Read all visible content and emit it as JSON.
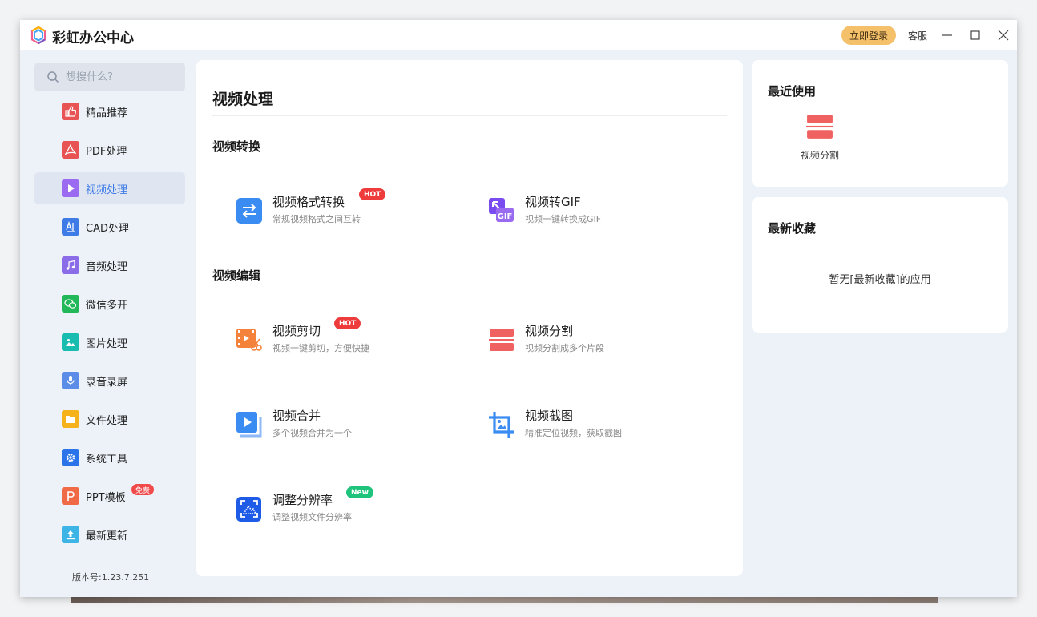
{
  "app": {
    "title": "彩虹办公中心",
    "login_label": "立即登录",
    "service_label": "客服"
  },
  "search": {
    "placeholder": "想搜什么?"
  },
  "sidebar": {
    "items": [
      {
        "label": "精品推荐",
        "icon": "thumbs-up-icon",
        "color": "#e85454"
      },
      {
        "label": "PDF处理",
        "icon": "pdf-icon",
        "color": "#e85454"
      },
      {
        "label": "视频处理",
        "icon": "video-play-icon",
        "color": "#9a6bf0",
        "active": true
      },
      {
        "label": "CAD处理",
        "icon": "cad-icon",
        "color": "#3f7be6"
      },
      {
        "label": "音频处理",
        "icon": "music-note-icon",
        "color": "#8a6be8"
      },
      {
        "label": "微信多开",
        "icon": "wechat-icon",
        "color": "#22b85a"
      },
      {
        "label": "图片处理",
        "icon": "image-icon",
        "color": "#19bdb0"
      },
      {
        "label": "录音录屏",
        "icon": "microphone-icon",
        "color": "#5b8de8"
      },
      {
        "label": "文件处理",
        "icon": "folder-icon",
        "color": "#f5b21a"
      },
      {
        "label": "系统工具",
        "icon": "gear-icon",
        "color": "#2a73e8"
      },
      {
        "label": "PPT模板",
        "icon": "ppt-icon",
        "color": "#ef6a45",
        "badge": "免费"
      },
      {
        "label": "最新更新",
        "icon": "upload-icon",
        "color": "#3cb4e6"
      }
    ],
    "version": "版本号:1.23.7.251"
  },
  "main": {
    "title": "视频处理",
    "sections": [
      {
        "title": "视频转换"
      },
      {
        "title": "视频编辑"
      }
    ],
    "tools": [
      {
        "name": "视频格式转换",
        "desc": "常规视频格式之间互转",
        "tag": "HOT",
        "icon": "swap-arrows-icon"
      },
      {
        "name": "视频转GIF",
        "desc": "视频一键转换成GIF",
        "tag": "",
        "icon": "gif-icon",
        "icon_text": "GIF"
      },
      {
        "name": "视频剪切",
        "desc": "视频一键剪切，方便快捷",
        "tag": "HOT",
        "icon": "scissors-film-icon"
      },
      {
        "name": "视频分割",
        "desc": "视频分割成多个片段",
        "tag": "",
        "icon": "split-icon"
      },
      {
        "name": "视频合并",
        "desc": "多个视频合并为一个",
        "tag": "",
        "icon": "merge-video-icon"
      },
      {
        "name": "视频截图",
        "desc": "精准定位视频，获取截图",
        "tag": "",
        "icon": "crop-image-icon"
      },
      {
        "name": "调整分辨率",
        "desc": "调整视频文件分辨率",
        "tag": "New",
        "icon": "resolution-icon"
      }
    ]
  },
  "recent": {
    "title": "最近使用",
    "items": [
      {
        "label": "视频分割",
        "icon": "split-icon"
      }
    ]
  },
  "favorites": {
    "title": "最新收藏",
    "empty": "暂无[最新收藏]的应用"
  }
}
